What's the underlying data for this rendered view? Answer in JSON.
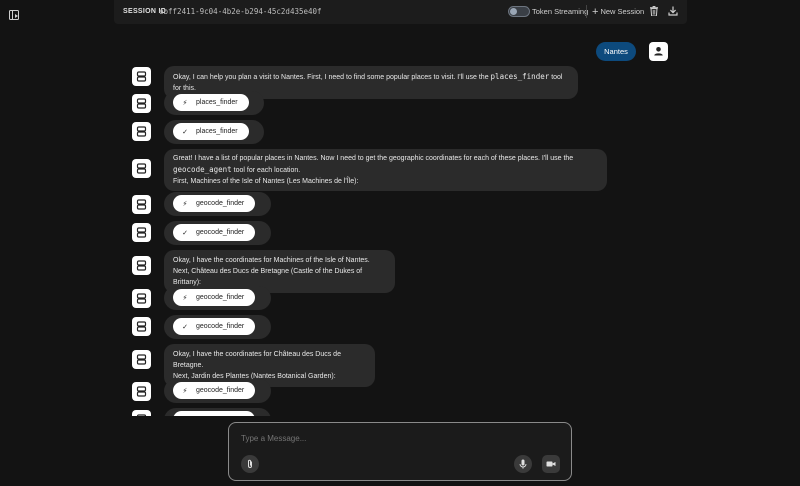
{
  "header": {
    "session_label": "SESSION ID",
    "session_id": "ebff2411-9c04-4b2e-b294-45c2d435e40f",
    "streaming_label": "Token Streaming",
    "new_session_label": "New Session"
  },
  "user_message": "Nantes",
  "messages": [
    {
      "type": "text",
      "lines": [
        "Okay, I can help you plan a visit to Nantes. First, I need to find some popular places to visit. I'll use the ",
        "places_finder",
        " tool for this."
      ]
    },
    {
      "type": "tool",
      "icon": "bolt",
      "name": "places_finder"
    },
    {
      "type": "tool",
      "icon": "check",
      "name": "places_finder"
    },
    {
      "type": "text2",
      "line1": "Great! I have a list of popular places in Nantes. Now I need to get the geographic coordinates for each of these places. I'll use the",
      "code": "geocode_agent",
      "after_code": " tool for each location.",
      "line3": "First, Machines of the Isle of Nantes (Les Machines de l'Île):"
    },
    {
      "type": "tool",
      "icon": "bolt",
      "name": "geocode_finder"
    },
    {
      "type": "tool",
      "icon": "check",
      "name": "geocode_finder"
    },
    {
      "type": "text",
      "l1": "Okay, I have the coordinates for Machines of the Isle of Nantes.",
      "l2": "Next, Château des Ducs de Bretagne (Castle of the Dukes of Brittany):"
    },
    {
      "type": "tool",
      "icon": "bolt",
      "name": "geocode_finder"
    },
    {
      "type": "tool",
      "icon": "check",
      "name": "geocode_finder"
    },
    {
      "type": "text",
      "l1": "Okay, I have the coordinates for Château des Ducs de Bretagne.",
      "l2": "Next, Jardin des Plantes (Nantes Botanical Garden):"
    },
    {
      "type": "tool",
      "icon": "bolt",
      "name": "geocode_finder"
    },
    {
      "type": "tool",
      "icon": "check",
      "name": "geocode_finder"
    }
  ],
  "composer": {
    "placeholder": "Type a Message..."
  },
  "icons": {
    "sidebar": "sidebar-toggle-icon",
    "trash": "trash-icon",
    "download": "download-icon",
    "attach": "paperclip-icon",
    "mic": "microphone-icon",
    "camera": "video-camera-icon",
    "bot": "bot-icon",
    "user": "user-icon"
  },
  "colors": {
    "user_bubble": "#0d4a7d",
    "bot_bubble": "#2b2b2b",
    "background": "#131313"
  }
}
